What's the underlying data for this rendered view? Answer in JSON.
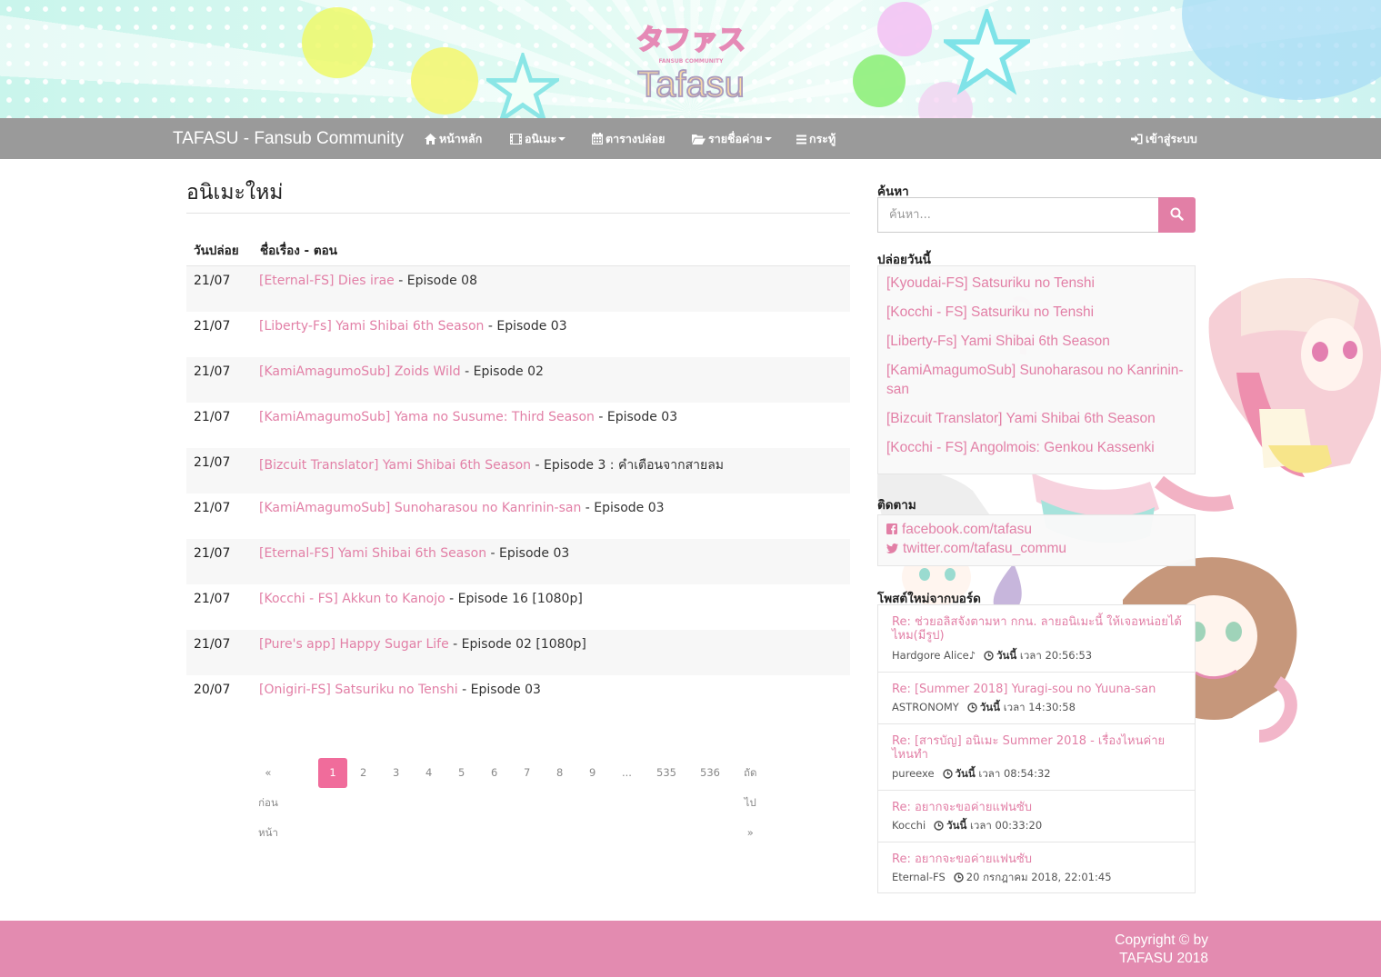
{
  "banner": {
    "logo_text_jp": "タファス",
    "logo_text_en": "Tafasu",
    "logo_subtext": "FANSUB COMMUNITY"
  },
  "navbar": {
    "brand": "TAFASU - Fansub Community",
    "items": [
      {
        "label": "หน้าหลัก",
        "icon": "home-icon"
      },
      {
        "label": "อนิเมะ",
        "icon": "film-icon",
        "dropdown": true
      },
      {
        "label": "ตารางปล่อย",
        "icon": "calendar-icon"
      },
      {
        "label": "รายชื่อค่าย",
        "icon": "folder-open-icon",
        "dropdown": true
      },
      {
        "label": "กระทู้",
        "icon": "bars-icon"
      }
    ],
    "login": {
      "label": "เข้าสู่ระบบ",
      "icon": "sign-in-icon"
    }
  },
  "main": {
    "title": "อนิเมะใหม่",
    "columns": [
      "วันปล่อย",
      "ชื่อเรื่อง - ตอน"
    ],
    "releases": [
      {
        "date": "21/07",
        "title": "[Eternal-FS] Dies irae",
        "episode": " - Episode 08"
      },
      {
        "date": "21/07",
        "title": "[Liberty-Fs] Yami Shibai 6th Season",
        "episode": " - Episode 03"
      },
      {
        "date": "21/07",
        "title": "[KamiAmagumoSub] Zoids Wild",
        "episode": " - Episode 02"
      },
      {
        "date": "21/07",
        "title": "[KamiAmagumoSub] Yama no Susume: Third Season",
        "episode": " - Episode 03"
      },
      {
        "date": "21/07",
        "title": "[Bizcuit Translator] Yami Shibai 6th Season",
        "episode": " - Episode 3 : คำเตือนจากสายลม"
      },
      {
        "date": "21/07",
        "title": "[KamiAmagumoSub] Sunoharasou no Kanrinin-san",
        "episode": " - Episode 03"
      },
      {
        "date": "21/07",
        "title": "[Eternal-FS] Yami Shibai 6th Season",
        "episode": " - Episode 03"
      },
      {
        "date": "21/07",
        "title": "[Kocchi - FS] Akkun to Kanojo",
        "episode": " - Episode 16 [1080p]"
      },
      {
        "date": "21/07",
        "title": "[Pure's app] Happy Sugar Life",
        "episode": " - Episode 02 [1080p]"
      },
      {
        "date": "20/07",
        "title": "[Onigiri-FS] Satsuriku no Tenshi",
        "episode": " - Episode 03"
      }
    ],
    "pagination": {
      "prev": "« ก่อนหน้า",
      "pages": [
        "1",
        "2",
        "3",
        "4",
        "5",
        "6",
        "7",
        "8",
        "9",
        "...",
        "535",
        "536"
      ],
      "active": "1",
      "next": "ถัดไป »"
    }
  },
  "sidebar": {
    "search": {
      "heading": "ค้นหา",
      "placeholder": "ค้นหา...",
      "icon": "search-icon"
    },
    "today": {
      "heading": "ปล่อยวันนี้",
      "items": [
        "[Kyoudai-FS] Satsuriku no Tenshi",
        "[Kocchi - FS] Satsuriku no Tenshi",
        "[Liberty-Fs] Yami Shibai 6th Season",
        "[KamiAmagumoSub] Sunoharasou no Kanrinin-san",
        "[Bizcuit Translator] Yami Shibai 6th Season",
        "[Kocchi - FS] Angolmois: Genkou Kassenki"
      ]
    },
    "follow": {
      "heading": "ติดตาม",
      "links": [
        {
          "label": "facebook.com/tafasu",
          "icon": "facebook-square-icon"
        },
        {
          "label": "twitter.com/tafasu_commu",
          "icon": "twitter-icon"
        }
      ]
    },
    "posts": {
      "heading": "โพสต์ใหม่จากบอร์ด",
      "items": [
        {
          "title": "Re: ช่วยอลิสจังตามหา กกน. ลายอนิเมะนี้ ให้เจอหน่อยได้ไหม(มีรูป)",
          "author": "Hardgore Alice♪",
          "day": "วันนี้",
          "time": "เวลา 20:56:53"
        },
        {
          "title": "Re: [Summer 2018] Yuragi-sou no Yuuna-san",
          "author": "ASTRONOMY",
          "day": "วันนี้",
          "time": "เวลา 14:30:58"
        },
        {
          "title": "Re: [สารบัญ] อนิเมะ Summer 2018 - เรื่องไหนค่ายไหนทำ",
          "author": "pureexe",
          "day": "วันนี้",
          "time": "เวลา 08:54:32"
        },
        {
          "title": "Re: อยากจะขอค่ายแฟนซับ",
          "author": "Kocchi",
          "day": "วันนี้",
          "time": "เวลา 00:33:20"
        },
        {
          "title": "Re: อยากจะขอค่ายแฟนซับ",
          "author": "Eternal-FS",
          "day": "",
          "time": "20 กรกฎาคม 2018, 22:01:45"
        }
      ]
    }
  },
  "footer": {
    "line1": "Copyright © by",
    "line2": "TAFASU 2018"
  },
  "colors": {
    "accent": "#e27fa6",
    "footer": "#e38bb0",
    "navbar": "#9a9a9a",
    "active_page": "#f06c9b"
  }
}
